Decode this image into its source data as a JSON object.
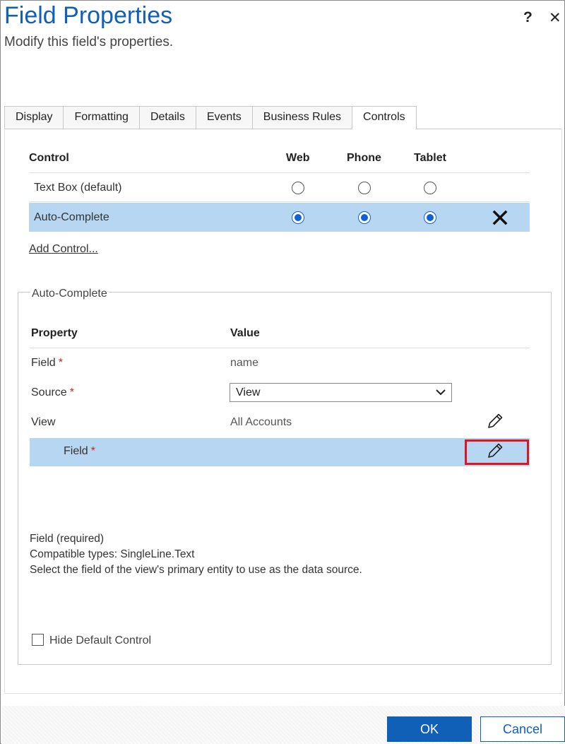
{
  "dialog": {
    "title": "Field Properties",
    "subtitle": "Modify this field's properties.",
    "help_label": "?",
    "close_label": "✕"
  },
  "tabs": [
    {
      "label": "Display"
    },
    {
      "label": "Formatting"
    },
    {
      "label": "Details"
    },
    {
      "label": "Events"
    },
    {
      "label": "Business Rules"
    },
    {
      "label": "Controls",
      "active": true
    }
  ],
  "controls_table": {
    "headers": {
      "control": "Control",
      "web": "Web",
      "phone": "Phone",
      "tablet": "Tablet"
    },
    "rows": [
      {
        "name": "Text Box (default)",
        "web": false,
        "phone": false,
        "tablet": false
      },
      {
        "name": "Auto-Complete",
        "web": true,
        "phone": true,
        "tablet": true,
        "selected": true
      }
    ],
    "add_control": "Add Control..."
  },
  "auto_complete": {
    "legend": "Auto-Complete",
    "headers": {
      "property": "Property",
      "value": "Value"
    },
    "rows": [
      {
        "name": "Field",
        "required": "*",
        "value": "name"
      },
      {
        "name": "Source",
        "required": "*",
        "value": "View"
      },
      {
        "name": "View",
        "value": "All Accounts"
      },
      {
        "name": "Field",
        "required": "*",
        "value": ""
      }
    ],
    "description": [
      "Field (required)",
      "Compatible types: SingleLine.Text",
      "Select the field of the view's primary entity to use as the data source."
    ],
    "hide_default_control": "Hide Default Control"
  },
  "footer": {
    "ok_label": "OK",
    "cancel_label": "Cancel"
  },
  "colors": {
    "accent": "#1160b7",
    "selected_row": "#b6d6f1",
    "required": "#c3252a",
    "highlight_box": "#e0141e"
  }
}
